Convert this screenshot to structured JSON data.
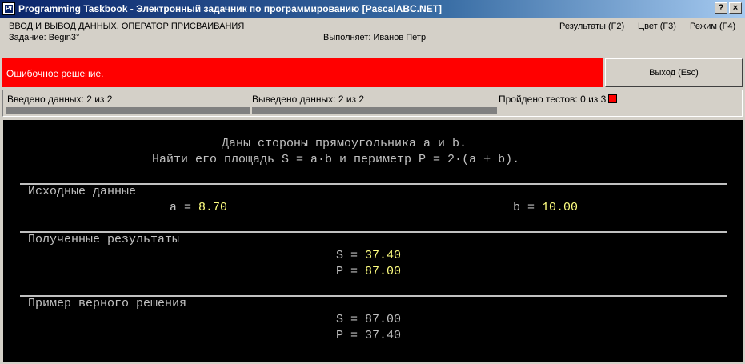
{
  "window": {
    "title": "Programming Taskbook - Электронный задачник по программированию [PascalABC.NET]",
    "help_button": "?",
    "close_button": "×"
  },
  "header": {
    "section": "ВВОД И ВЫВОД ДАННЫХ, ОПЕРАТОР ПРИСВАИВАНИЯ",
    "task": "Задание: Begin3°",
    "student": "Выполняет: Иванов Петр",
    "menu": {
      "results": "Результаты (F2)",
      "color": "Цвет (F3)",
      "mode": "Режим (F4)"
    }
  },
  "status": {
    "message": "Ошибочное решение.",
    "exit_label": "Выход (Esc)",
    "colors": {
      "error_bg": "#ff0000",
      "value_highlight": "#ffff80"
    }
  },
  "info": {
    "input": "Введено данных: 2 из 2",
    "output": "Выведено данных: 2 из 2",
    "tests": "Пройдено тестов: 0 из 3"
  },
  "task": {
    "line1": "Даны стороны прямоугольника a и b.",
    "line2": "Найти его площадь S = a·b и периметр P = 2·(a + b).",
    "input_header": "Исходные данные",
    "a_label": "a = ",
    "a_value": "8.70",
    "b_label": "b = ",
    "b_value": "10.00",
    "results_header": "Полученные результаты",
    "res_s_label": "S = ",
    "res_s_value": "37.40",
    "res_p_label": "P = ",
    "res_p_value": "87.00",
    "example_header": "Пример верного решения",
    "ex_s": "S = 87.00",
    "ex_p": "P = 37.40"
  }
}
